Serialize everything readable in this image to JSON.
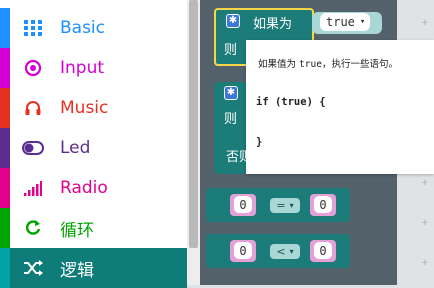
{
  "toolbox": {
    "categories": [
      {
        "label": "Basic",
        "icon": "grid-icon",
        "color": "#1e90ff"
      },
      {
        "label": "Input",
        "icon": "target-icon",
        "color": "#d400d4"
      },
      {
        "label": "Music",
        "icon": "headphones-icon",
        "color": "#e63022"
      },
      {
        "label": "Led",
        "icon": "toggle-icon",
        "color": "#5c2d91"
      },
      {
        "label": "Radio",
        "icon": "signal-bars-icon",
        "color": "#e3008c"
      },
      {
        "label": "循环",
        "icon": "refresh-icon",
        "color": "#00a400"
      },
      {
        "label": "逻辑",
        "icon": "shuffle-icon",
        "color": "#00a4a6",
        "selected": true
      }
    ]
  },
  "blocks": {
    "if_else_top": {
      "if_label": "如果为",
      "then_label": "则",
      "dropdown_value": "true",
      "dropdown_arrow": "▾"
    },
    "if_else_second": {
      "then_label": "则",
      "else_label": "否则"
    },
    "compare_eq": {
      "left": "0",
      "op": "=",
      "right": "0"
    },
    "compare_lt": {
      "left": "0",
      "op": "<",
      "right": "0"
    }
  },
  "tooltip": {
    "description_prefix": "如果值为",
    "description_code": "true",
    "description_suffix": "，执行一些语句。",
    "code_line1": "if (true) {",
    "code_line2": "}"
  }
}
